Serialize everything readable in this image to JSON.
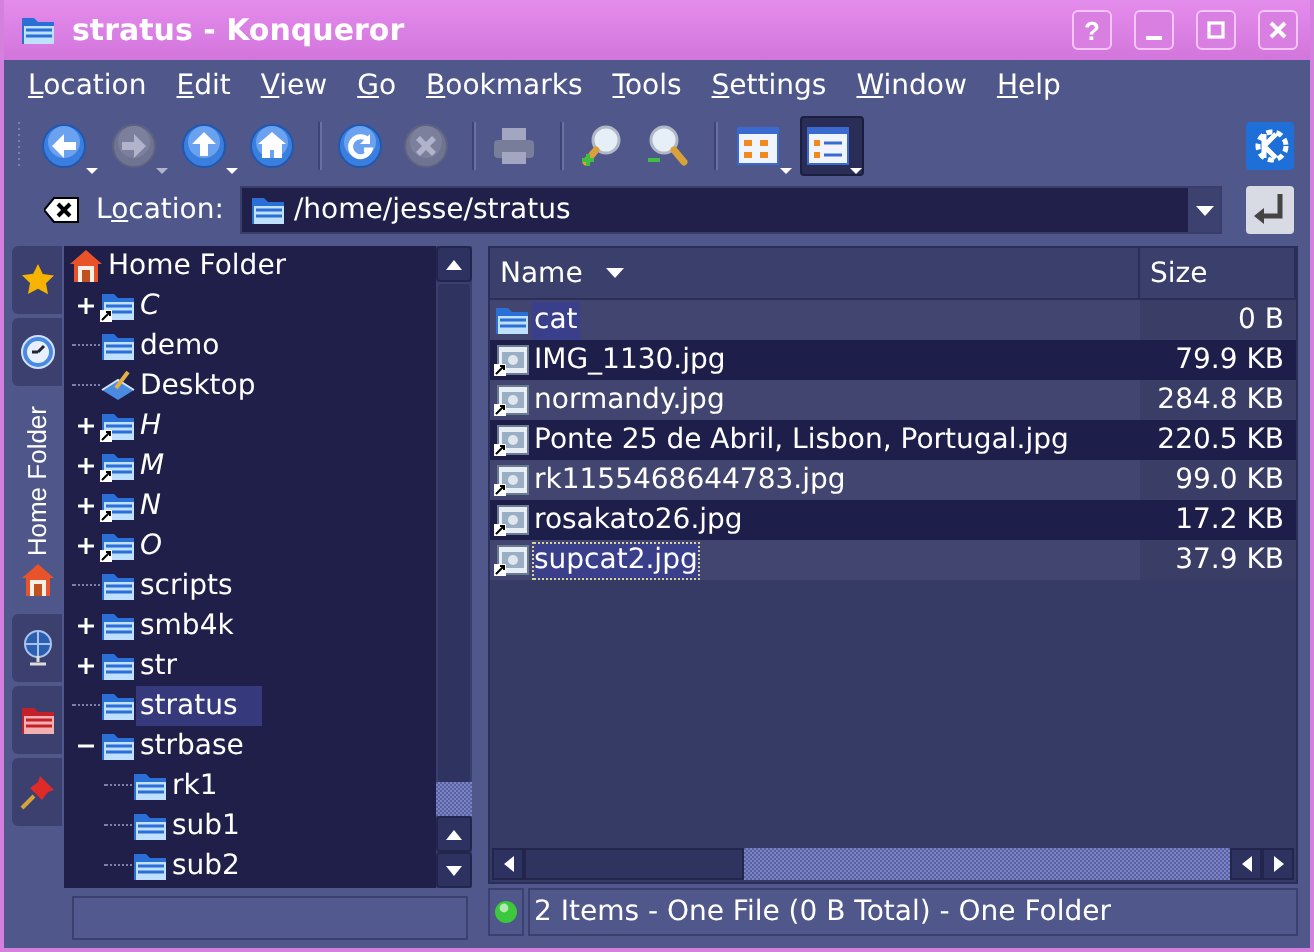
{
  "window": {
    "title": "stratus - Konqueror",
    "buttons": [
      {
        "kind": "help",
        "label": "?"
      },
      {
        "kind": "minimize"
      },
      {
        "kind": "maximize"
      },
      {
        "kind": "close"
      }
    ]
  },
  "menu": [
    {
      "accel": "L",
      "rest": "ocation"
    },
    {
      "accel": "E",
      "rest": "dit"
    },
    {
      "accel": "V",
      "rest": "iew"
    },
    {
      "accel": "G",
      "rest": "o"
    },
    {
      "accel": "B",
      "rest": "ookmarks"
    },
    {
      "accel": "T",
      "rest": "ools"
    },
    {
      "accel": "S",
      "rest": "ettings"
    },
    {
      "accel": "W",
      "rest": "indow"
    },
    {
      "accel": "H",
      "rest": "elp"
    }
  ],
  "toolbar": [
    {
      "kind": "back",
      "disabled": false,
      "dropdown": true,
      "pressed": false
    },
    {
      "kind": "forward",
      "disabled": true,
      "dropdown": true,
      "pressed": false
    },
    {
      "kind": "up",
      "disabled": false,
      "dropdown": true,
      "pressed": false
    },
    {
      "kind": "home",
      "disabled": false,
      "dropdown": false,
      "pressed": false
    },
    {
      "kind": "separator"
    },
    {
      "kind": "reload",
      "disabled": false,
      "dropdown": false,
      "pressed": false
    },
    {
      "kind": "stop",
      "disabled": true,
      "dropdown": false,
      "pressed": false
    },
    {
      "kind": "separator"
    },
    {
      "kind": "print",
      "disabled": true,
      "dropdown": false,
      "pressed": false
    },
    {
      "kind": "separator"
    },
    {
      "kind": "zoom_in",
      "disabled": false,
      "dropdown": false,
      "pressed": false
    },
    {
      "kind": "zoom_out",
      "disabled": false,
      "dropdown": false,
      "pressed": false
    },
    {
      "kind": "separator"
    },
    {
      "kind": "icon_view",
      "disabled": false,
      "dropdown": true,
      "pressed": false
    },
    {
      "kind": "detail_view",
      "disabled": false,
      "dropdown": true,
      "pressed": true
    }
  ],
  "location": {
    "label": {
      "before": "L",
      "accel": "o",
      "after": "cation:"
    },
    "value": "/home/jesse/stratus"
  },
  "sidebar": {
    "tabs": [
      {
        "kind": "bookmarks",
        "selected": false
      },
      {
        "kind": "history",
        "selected": false
      },
      {
        "kind": "home",
        "label": "Home Folder",
        "selected": true
      },
      {
        "kind": "network",
        "selected": false
      },
      {
        "kind": "services",
        "selected": false
      },
      {
        "kind": "pinned",
        "selected": false
      }
    ]
  },
  "tree": {
    "root": {
      "label": "Home Folder",
      "kind": "home",
      "children": [
        {
          "label": "C",
          "kind": "link",
          "expanded": false,
          "selected": false
        },
        {
          "label": "demo",
          "kind": "folder",
          "selected": false
        },
        {
          "label": "Desktop",
          "kind": "desktop",
          "selected": false
        },
        {
          "label": "H",
          "kind": "link",
          "expanded": false,
          "selected": false
        },
        {
          "label": "M",
          "kind": "link",
          "expanded": false,
          "selected": false
        },
        {
          "label": "N",
          "kind": "link",
          "expanded": false,
          "selected": false
        },
        {
          "label": "O",
          "kind": "link",
          "expanded": false,
          "selected": false
        },
        {
          "label": "scripts",
          "kind": "folder",
          "selected": false
        },
        {
          "label": "smb4k",
          "kind": "folder",
          "expanded": false,
          "selected": false
        },
        {
          "label": "str",
          "kind": "folder",
          "expanded": false,
          "selected": false
        },
        {
          "label": "stratus",
          "kind": "folder",
          "selected": true
        },
        {
          "label": "strbase",
          "kind": "folder",
          "expanded": true,
          "selected": false,
          "children": [
            {
              "label": "rk1",
              "kind": "folder",
              "selected": false
            },
            {
              "label": "sub1",
              "kind": "folder",
              "selected": false
            },
            {
              "label": "sub2",
              "kind": "folder",
              "selected": false
            }
          ]
        }
      ]
    }
  },
  "files": {
    "columns": [
      {
        "label": "Name",
        "sorted": true
      },
      {
        "label": "Size",
        "sorted": false
      }
    ],
    "rows": [
      {
        "name": "cat",
        "size": "0 B",
        "kind": "folder",
        "link": false,
        "selected": true,
        "focused": false
      },
      {
        "name": "IMG_1130.jpg",
        "size": "79.9 KB",
        "kind": "image",
        "link": true,
        "selected": false,
        "focused": false
      },
      {
        "name": "normandy.jpg",
        "size": "284.8 KB",
        "kind": "image",
        "link": true,
        "selected": false,
        "focused": false
      },
      {
        "name": "Ponte 25 de Abril, Lisbon, Portugal.jpg",
        "size": "220.5 KB",
        "kind": "image",
        "link": true,
        "selected": false,
        "focused": false
      },
      {
        "name": "rk1155468644783.jpg",
        "size": "99.0 KB",
        "kind": "image",
        "link": true,
        "selected": false,
        "focused": false
      },
      {
        "name": "rosakato26.jpg",
        "size": "17.2 KB",
        "kind": "image",
        "link": true,
        "selected": false,
        "focused": false
      },
      {
        "name": "supcat2.jpg",
        "size": "37.9 KB",
        "kind": "image",
        "link": true,
        "selected": true,
        "focused": true
      }
    ]
  },
  "status_bar": {
    "text": "2 Items - One File (0 B Total) - One Folder",
    "online": true
  }
}
